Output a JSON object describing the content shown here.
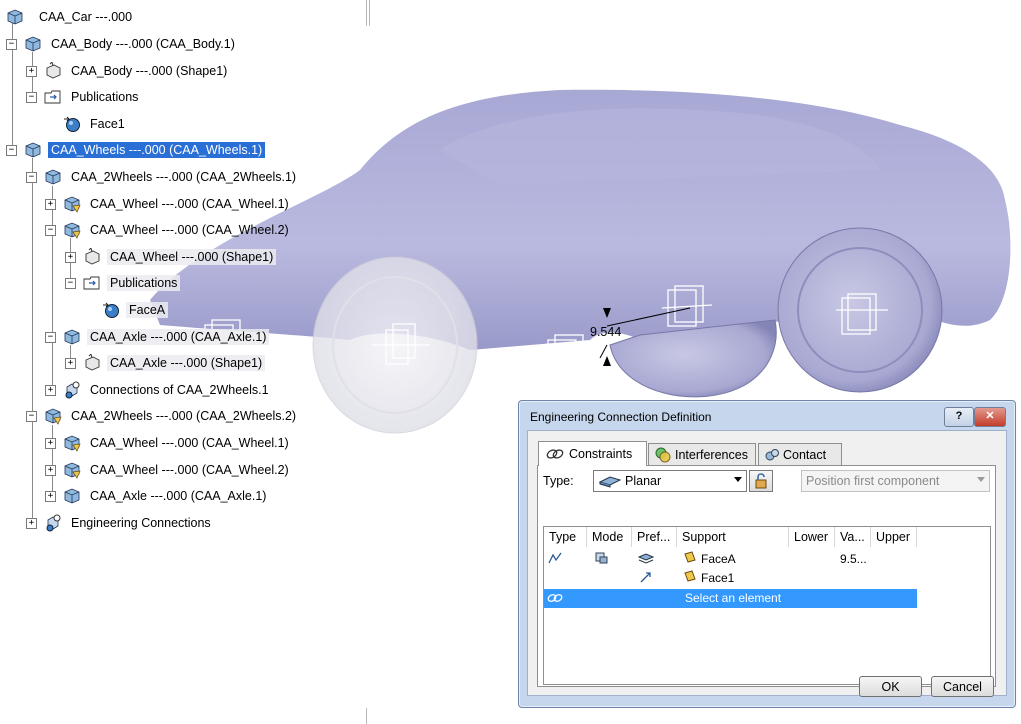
{
  "tree": {
    "root": "CAA_Car ---.000",
    "items": [
      {
        "label": "CAA_Body ---.000 (CAA_Body.1)"
      },
      {
        "label": "CAA_Body ---.000 (Shape1)"
      },
      {
        "label": "Publications"
      },
      {
        "label": "Face1"
      },
      {
        "label": "CAA_Wheels ---.000 (CAA_Wheels.1)"
      },
      {
        "label": "CAA_2Wheels ---.000 (CAA_2Wheels.1)"
      },
      {
        "label": "CAA_Wheel ---.000 (CAA_Wheel.1)"
      },
      {
        "label": "CAA_Wheel ---.000 (CAA_Wheel.2)"
      },
      {
        "label": "CAA_Wheel ---.000 (Shape1)"
      },
      {
        "label": "Publications"
      },
      {
        "label": "FaceA"
      },
      {
        "label": "CAA_Axle ---.000 (CAA_Axle.1)"
      },
      {
        "label": "CAA_Axle ---.000 (Shape1)"
      },
      {
        "label": "Connections of CAA_2Wheels.1"
      },
      {
        "label": "CAA_2Wheels ---.000 (CAA_2Wheels.2)"
      },
      {
        "label": "CAA_Wheel ---.000 (CAA_Wheel.1)"
      },
      {
        "label": "CAA_Wheel ---.000 (CAA_Wheel.2)"
      },
      {
        "label": "CAA_Axle ---.000 (CAA_Axle.1)"
      },
      {
        "label": "Engineering Connections"
      }
    ]
  },
  "viewport": {
    "dimension_value": "9.544",
    "car_color": "#a9a9d4"
  },
  "dialog": {
    "title": "Engineering Connection Definition",
    "help_label": "?",
    "close_label": "✕",
    "tabs": [
      "Constraints",
      "Interferences",
      "Contact"
    ],
    "type_label": "Type:",
    "type_value": "Planar",
    "position_value": "Position first component",
    "columns": [
      "Type",
      "Mode",
      "Pref...",
      "Support",
      "Lower",
      "Va...",
      "Upper"
    ],
    "rows": [
      {
        "support": "FaceA",
        "value": "9.5..."
      },
      {
        "support": "Face1",
        "value": ""
      }
    ],
    "select_prompt": "Select an element",
    "ok_label": "OK",
    "cancel_label": "Cancel"
  },
  "colors": {
    "selection": "#2a6fd6",
    "row_highlight": "#3399ff",
    "dialog_frame": "#c6d6ec",
    "close_red": "#c94a3a"
  }
}
